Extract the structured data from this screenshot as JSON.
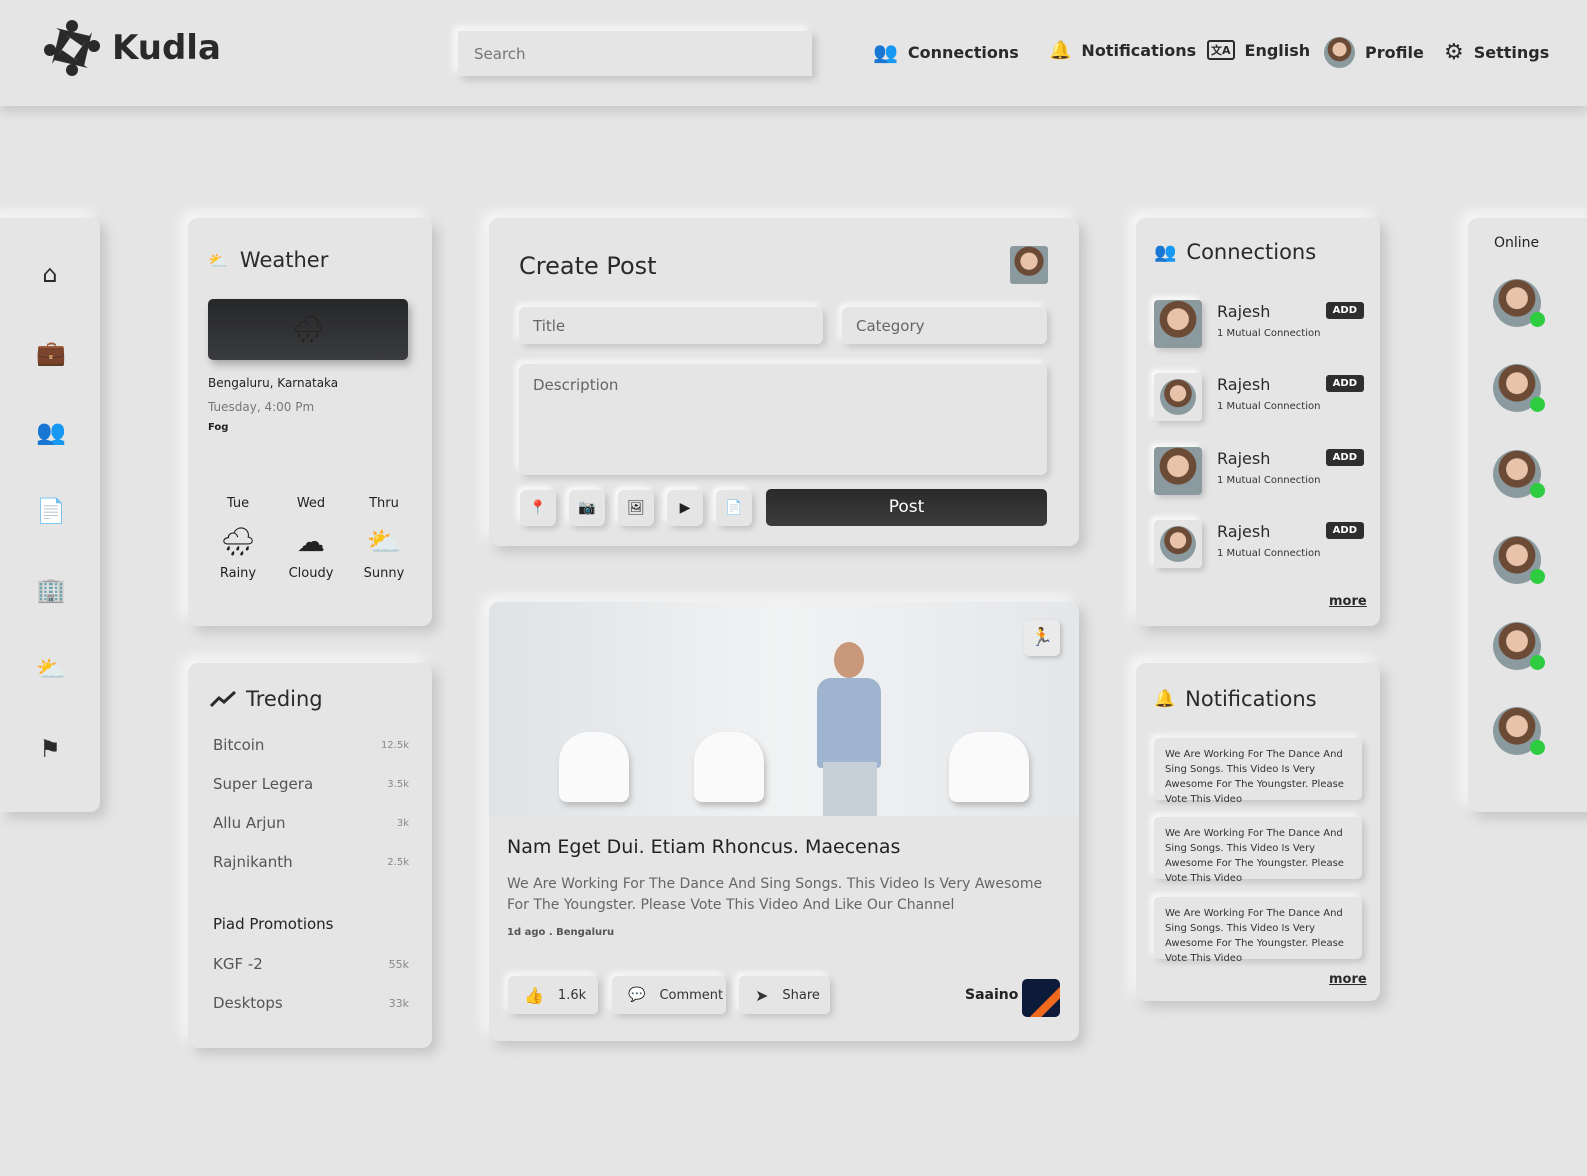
{
  "header": {
    "brand": "Kudla",
    "search_placeholder": "Search",
    "nav": [
      {
        "label": "Connections",
        "icon": "users-icon"
      },
      {
        "label": "Notifications",
        "icon": "bell-icon"
      },
      {
        "label": "English",
        "icon": "translate-icon"
      },
      {
        "label": "Profile",
        "icon": "avatar"
      },
      {
        "label": "Settings",
        "icon": "gear-icon"
      }
    ]
  },
  "sidebar": {
    "icons": [
      "home-icon",
      "briefcase-icon",
      "users-icon",
      "documents-icon",
      "building-icon",
      "weather-icon",
      "flag-icon"
    ]
  },
  "weather": {
    "title": "Weather",
    "location": "Bengaluru, Karnataka",
    "datetime": "Tuesday, 4:00 Pm",
    "condition": "Fog",
    "forecast": [
      {
        "day": "Tue",
        "label": "Rainy"
      },
      {
        "day": "Wed",
        "label": "Cloudy"
      },
      {
        "day": "Thru",
        "label": "Sunny"
      }
    ]
  },
  "trending": {
    "title": "Treding",
    "items": [
      {
        "name": "Bitcoin",
        "count": "12.5k"
      },
      {
        "name": "Super Legera",
        "count": "3.5k"
      },
      {
        "name": "Allu Arjun",
        "count": "3k"
      },
      {
        "name": "Rajnikanth",
        "count": "2.5k"
      }
    ],
    "promo_title": "Piad Promotions",
    "promos": [
      {
        "name": "KGF -2",
        "count": "55k"
      },
      {
        "name": "Desktops",
        "count": "33k"
      }
    ]
  },
  "create_post": {
    "title": "Create Post",
    "title_placeholder": "Title",
    "category_placeholder": "Category",
    "description_placeholder": "Description",
    "post_label": "Post"
  },
  "post": {
    "heading": "Nam Eget Dui. Etiam Rhoncus. Maecenas",
    "body": "We Are Working For The Dance And Sing Songs. This Video Is Very Awesome For The Youngster. Please Vote This Video And Like Our Channel",
    "meta": "1d ago . Bengaluru",
    "likes": "1.6k",
    "comment_label": "Comment",
    "share_label": "Share",
    "author": "Saaino"
  },
  "connections": {
    "title": "Connections",
    "items": [
      {
        "name": "Rajesh",
        "mutual": "1 Mutual Connection",
        "add": "ADD"
      },
      {
        "name": "Rajesh",
        "mutual": "1 Mutual Connection",
        "add": "ADD"
      },
      {
        "name": "Rajesh",
        "mutual": "1 Mutual Connection",
        "add": "ADD"
      },
      {
        "name": "Rajesh",
        "mutual": "1 Mutual Connection",
        "add": "ADD"
      }
    ],
    "more": "more"
  },
  "notifications": {
    "title": "Notifications",
    "items": [
      "We Are Working For The Dance And Sing Songs. This Video Is Very Awesome For The Youngster. Please Vote This Video",
      "We Are Working For The Dance And Sing Songs. This Video Is Very Awesome For The Youngster. Please Vote This Video",
      "We Are Working For The Dance And Sing Songs. This Video Is Very Awesome For The Youngster. Please Vote This Video"
    ],
    "more": "more"
  },
  "online": {
    "title": "Online",
    "count_shown": 6
  },
  "colors": {
    "background": "#e5e5e5",
    "dark": "#2e2e2e",
    "online": "#2ecc40"
  }
}
